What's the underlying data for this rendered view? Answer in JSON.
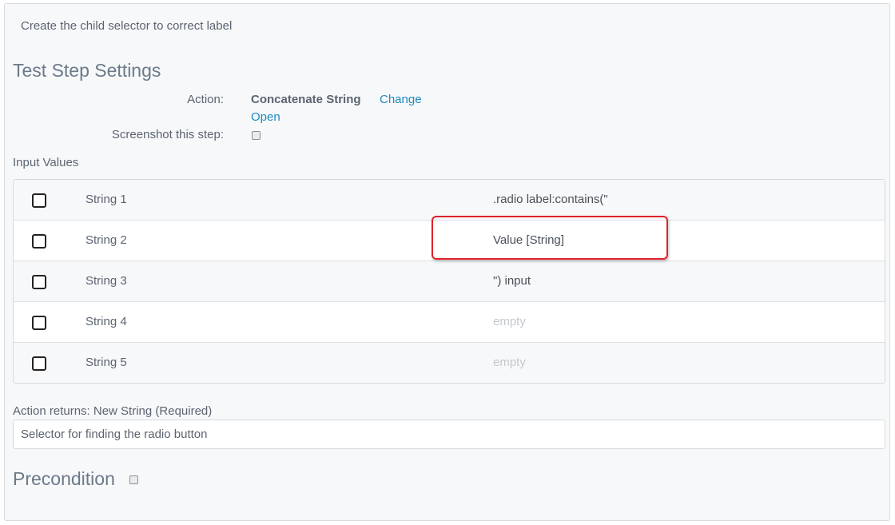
{
  "step": {
    "description": "Create the child selector to correct label"
  },
  "settings": {
    "title": "Test Step Settings",
    "action_label": "Action:",
    "action_value": "Concatenate String",
    "change_link": "Change",
    "open_link": "Open",
    "screenshot_label": "Screenshot this step:",
    "screenshot_checked": false
  },
  "input_values": {
    "label": "Input Values",
    "rows": [
      {
        "name": "String 1",
        "value": ".radio label:contains(\"",
        "is_empty": false
      },
      {
        "name": "String 2",
        "value": "Value [String]",
        "is_empty": false,
        "highlighted": true
      },
      {
        "name": "String 3",
        "value": "\") input",
        "is_empty": false
      },
      {
        "name": "String 4",
        "value": "empty",
        "is_empty": true
      },
      {
        "name": "String 5",
        "value": "empty",
        "is_empty": true
      }
    ]
  },
  "returns": {
    "label": "Action returns: New String (Required)",
    "value": "Selector for finding the radio button"
  },
  "precondition": {
    "title": "Precondition",
    "checked": false
  },
  "colors": {
    "accent_link": "#1a8ac3",
    "highlight": "#e0232a",
    "panel_bg": "#f7f8fa"
  }
}
